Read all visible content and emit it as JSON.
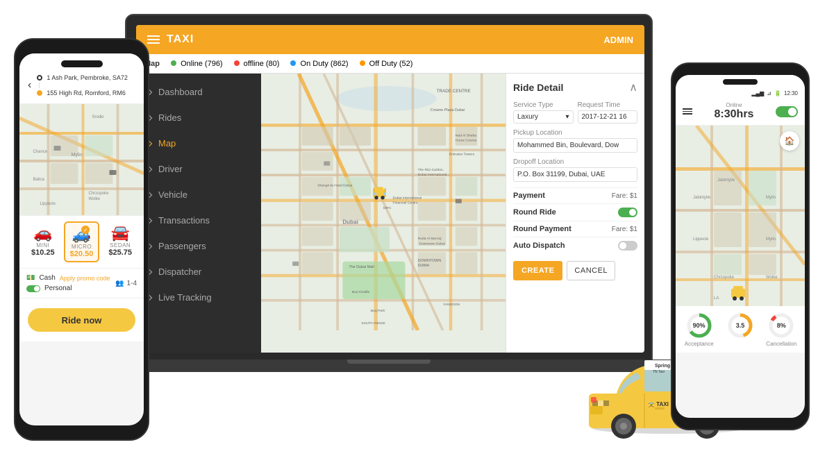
{
  "app": {
    "title": "TAXI",
    "admin_label": "ADMIN",
    "hamburger_icon": "hamburger-icon"
  },
  "map_status": {
    "label": "Map",
    "online": "Online (796)",
    "offline": "offline (80)",
    "on_duty": "On Duty (862)",
    "off_duty": "Off Duty (52)"
  },
  "sidebar": {
    "items": [
      {
        "label": "Dashboard",
        "active": false
      },
      {
        "label": "Rides",
        "active": false
      },
      {
        "label": "Map",
        "active": true
      },
      {
        "label": "Driver",
        "active": false
      },
      {
        "label": "Vehicle",
        "active": false
      },
      {
        "label": "Transactions",
        "active": false
      },
      {
        "label": "Passengers",
        "active": false
      },
      {
        "label": "Dispatcher",
        "active": false
      },
      {
        "label": "Live Tracking",
        "active": false
      }
    ]
  },
  "ride_detail": {
    "title": "Ride Detail",
    "service_type_label": "Service Type",
    "service_type_value": "Laxury",
    "request_time_label": "Request Time",
    "request_time_value": "2017-12-21 16",
    "pickup_label": "Pickup Location",
    "pickup_value": "Mohammed Bin, Boulevard, Dow",
    "dropoff_label": "Dropoff Location",
    "dropoff_value": "P.O. Box 31199, Dubai, UAE",
    "payment_label": "Payment",
    "payment_value": "Fare: $1",
    "round_ride_label": "Round Ride",
    "round_payment_label": "Round Payment",
    "round_payment_value": "Fare: $1",
    "auto_dispatch_label": "Auto Dispatch",
    "create_btn": "CREATE",
    "cancel_btn": "CANCEL"
  },
  "left_phone": {
    "from_address": "1 Ash Park, Pembroke, SA72",
    "to_address": "155 High Rd, Romford, RM6",
    "vehicles": [
      {
        "name": "MINI",
        "price": "$10.25",
        "selected": false,
        "icon": "🚗"
      },
      {
        "name": "MICRO",
        "price": "$20.50",
        "selected": true,
        "icon": "🚙"
      },
      {
        "name": "SEDAN",
        "price": "$25.75",
        "selected": false,
        "icon": "🚘"
      }
    ],
    "payment_type": "Cash",
    "payment_icon": "💵",
    "personal_label": "Personal",
    "passengers": "1-4",
    "promo_label": "Apply promo code",
    "ride_now_btn": "Ride now"
  },
  "right_phone": {
    "time": "8:30hrs",
    "online_label": "Online",
    "stats": [
      {
        "value": "90%",
        "label": "Acceptance",
        "color": "#4caf50",
        "pct": 90
      },
      {
        "value": "3.5",
        "label": "",
        "color": "#f5a623",
        "pct": 70
      },
      {
        "value": "8%",
        "label": "Cancellation",
        "color": "#f44336",
        "pct": 8
      }
    ]
  },
  "map_labels": [
    "TRADE CENTRE",
    "Crowne Plaza Dubai",
    "Nad Al Sheba Horse Course",
    "Emirates Towers",
    "The Ritz-Carlton, Dubai International...",
    "Dubai International Financial Centre",
    "DIFC",
    "Shangri-la Hotel Dubai",
    "Dubai",
    "The Dubai Mall",
    "Burj Khalifa",
    "Roda Al Murooj Downtown Dubai",
    "DOWNTOWN DUBAI",
    "Burj Park",
    "YANSOON",
    "SOUTH RIDGE"
  ]
}
